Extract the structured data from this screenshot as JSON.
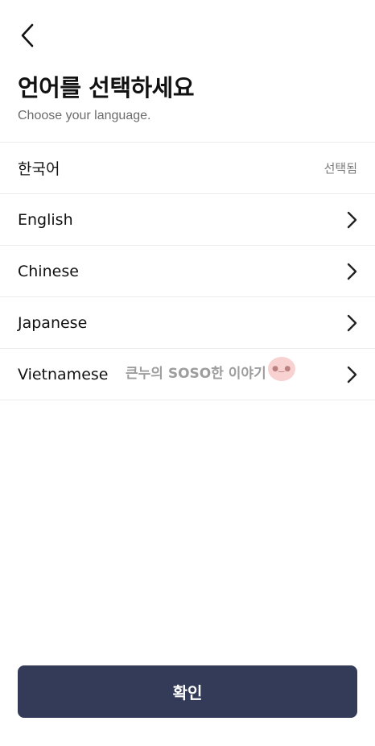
{
  "header": {
    "back_icon": "chevron-left-icon",
    "title": "언어를 선택하세요",
    "subtitle": "Choose your language."
  },
  "languages": [
    {
      "label": "한국어",
      "status": "선택됨",
      "selected": true
    },
    {
      "label": "English",
      "icon": "chevron-right-icon"
    },
    {
      "label": "Chinese",
      "icon": "chevron-right-icon"
    },
    {
      "label": "Japanese",
      "icon": "chevron-right-icon"
    },
    {
      "label": "Vietnamese",
      "icon": "chevron-right-icon"
    }
  ],
  "watermark": {
    "text": "큰누의 SOSO한 이야기"
  },
  "footer": {
    "confirm_label": "확인"
  },
  "colors": {
    "primary_button": "#333b59",
    "divider": "#ececec",
    "muted_text": "#7a7a7a"
  }
}
